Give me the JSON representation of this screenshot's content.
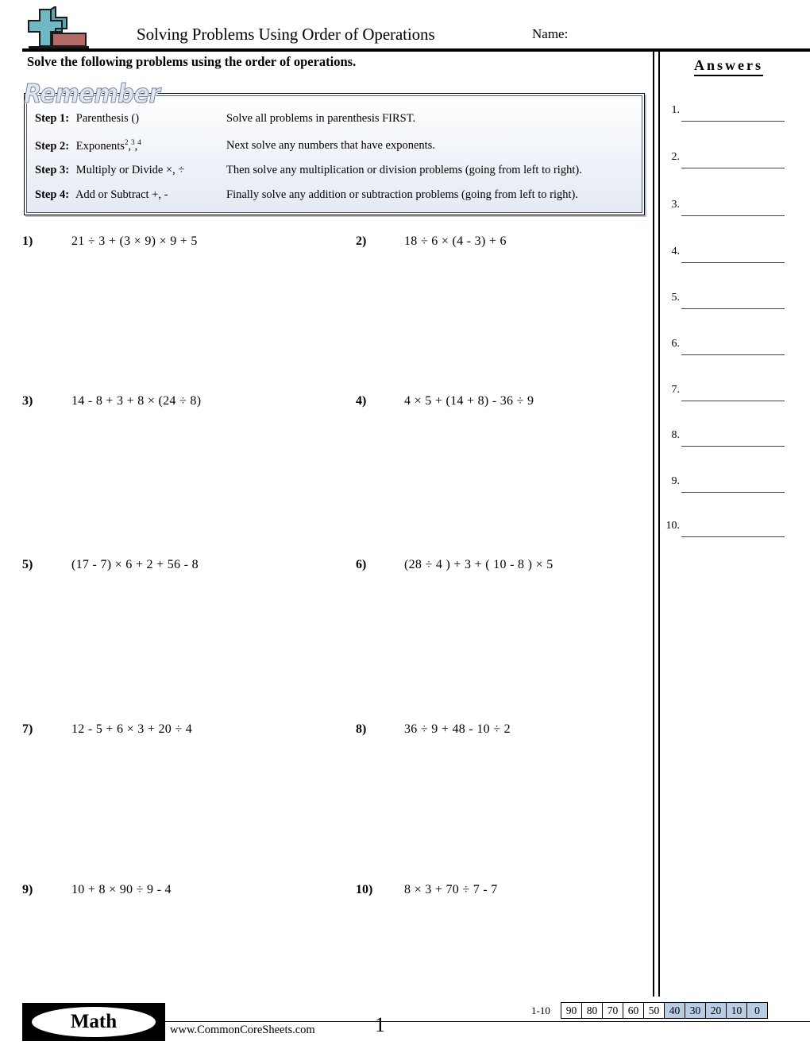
{
  "header": {
    "title": "Solving Problems Using Order of Operations",
    "name_label": "Name:",
    "instructions": "Solve the following problems using the order of operations.",
    "logo_icon": "plus-sign-logo"
  },
  "remember": {
    "heading": "Remember",
    "steps": [
      {
        "label": "Step 1:",
        "operation": "Parenthesis ()",
        "description": "Solve all problems in parenthesis FIRST."
      },
      {
        "label": "Step 2:",
        "operation": "Exponents",
        "exponents": [
          "2",
          "3",
          "4"
        ],
        "description": "Next solve any numbers that have exponents."
      },
      {
        "label": "Step 3:",
        "operation": "Multiply or Divide ×, ÷",
        "description": "Then solve any multiplication or division problems (going from left to right)."
      },
      {
        "label": "Step 4:",
        "operation": "Add or Subtract +, -",
        "description": "Finally solve any addition or subtraction problems (going from left to right)."
      }
    ]
  },
  "problems": [
    {
      "number": "1)",
      "expression": "21 ÷ 3 + (3 × 9) × 9 + 5"
    },
    {
      "number": "2)",
      "expression": "18 ÷ 6 × (4 - 3) + 6"
    },
    {
      "number": "3)",
      "expression": "14 - 8 + 3 + 8 × (24 ÷ 8)"
    },
    {
      "number": "4)",
      "expression": "4 × 5 + (14 + 8) - 36 ÷ 9"
    },
    {
      "number": "5)",
      "expression": "(17 - 7) × 6 + 2 + 56 - 8"
    },
    {
      "number": "6)",
      "expression": "(28 ÷ 4 ) + 3 + ( 10 - 8 ) × 5"
    },
    {
      "number": "7)",
      "expression": "12 - 5 + 6 × 3 + 20 ÷ 4"
    },
    {
      "number": "8)",
      "expression": "36 ÷ 9 + 48 - 10 ÷ 2"
    },
    {
      "number": "9)",
      "expression": "10 + 8 × 90 ÷ 9 - 4"
    },
    {
      "number": "10)",
      "expression": "8 × 3 + 70 ÷ 7 - 7"
    }
  ],
  "answers": {
    "title": "Answers",
    "items": [
      "1.",
      "2.",
      "3.",
      "4.",
      "5.",
      "6.",
      "7.",
      "8.",
      "9.",
      "10."
    ]
  },
  "footer": {
    "logo_text": "Math",
    "url": "www.CommonCoreSheets.com",
    "page_number": "1",
    "score_label": "1-10",
    "score_values": [
      "90",
      "80",
      "70",
      "60",
      "50",
      "40",
      "30",
      "20",
      "10",
      "0"
    ],
    "score_highlighted": [
      "40",
      "30",
      "20",
      "10",
      "0"
    ],
    "highlight_color": "#b8cce4"
  }
}
